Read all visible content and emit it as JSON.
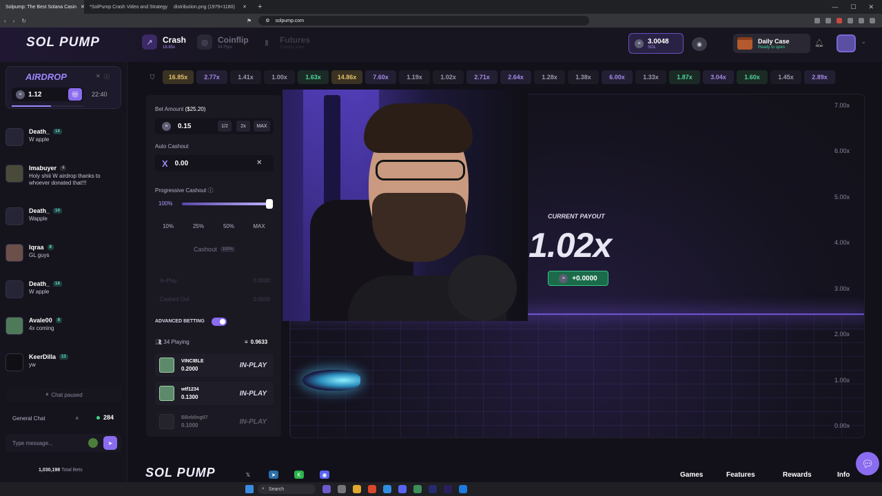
{
  "browser": {
    "tabs": [
      {
        "title": "Solpump: The Best Solana Casin",
        "active": true
      },
      {
        "title": "*SolPump Crash Video and Strategy",
        "active": false
      },
      {
        "title": "distribution.png (1979×1180)",
        "active": false
      }
    ],
    "url": "solpump.com"
  },
  "header": {
    "logo": "SOL PUMP",
    "games": [
      {
        "name": "Crash",
        "sub": "18.85x",
        "icon": "chart-up-icon"
      },
      {
        "name": "Coinflip",
        "sub": "34 Flips",
        "icon": "coin-icon"
      },
      {
        "name": "Futures",
        "sub": "Coming soon",
        "icon": "bars-icon"
      }
    ],
    "balance": {
      "amount": "3.0048",
      "currency": "SOL"
    },
    "daily_case": {
      "title": "Daily Case",
      "status": "Ready to open"
    }
  },
  "airdrop": {
    "title": "AIRDROP",
    "amount": "1.12",
    "timer": "22:40",
    "progress": 0.55
  },
  "chat": {
    "messages": [
      {
        "user": "Death_",
        "level": "14",
        "text": "W apple"
      },
      {
        "user": "Imabuyer",
        "level": "4",
        "text": "Holy shiii W airdrop thanks to whoever donated that!!!"
      },
      {
        "user": "Death_",
        "level": "14",
        "text": "Wapple"
      },
      {
        "user": "Iqraa",
        "level": "8",
        "text": "GL guys"
      },
      {
        "user": "Death_",
        "level": "14",
        "text": "W apple"
      },
      {
        "user": "Avale00",
        "level": "8",
        "text": "4x coming"
      },
      {
        "user": "KeerDilla",
        "level": "13",
        "text": "yw"
      }
    ],
    "paused_label": "Chat paused",
    "channel": "General Chat",
    "online": "284",
    "placeholder": "Type message...",
    "total_bets_value": "1,030,198",
    "total_bets_label": "Total Bets"
  },
  "history": [
    {
      "v": "16.85x",
      "color": "#e3c16a",
      "bg": "#3a3222"
    },
    {
      "v": "2.77x",
      "color": "#a48ae6",
      "bg": "#231f33"
    },
    {
      "v": "1.41x",
      "color": "#9a98ac",
      "bg": "#1c1b26"
    },
    {
      "v": "1.00x",
      "color": "#9a98ac",
      "bg": "#1c1b26"
    },
    {
      "v": "1.63x",
      "color": "#4fd39a",
      "bg": "#1b2a25"
    },
    {
      "v": "14.86x",
      "color": "#e3c16a",
      "bg": "#3a3222"
    },
    {
      "v": "7.60x",
      "color": "#a48ae6",
      "bg": "#231f33"
    },
    {
      "v": "1.19x",
      "color": "#9a98ac",
      "bg": "#1c1b26"
    },
    {
      "v": "1.02x",
      "color": "#9a98ac",
      "bg": "#1c1b26"
    },
    {
      "v": "2.71x",
      "color": "#a48ae6",
      "bg": "#231f33"
    },
    {
      "v": "2.64x",
      "color": "#a48ae6",
      "bg": "#231f33"
    },
    {
      "v": "1.28x",
      "color": "#9a98ac",
      "bg": "#1c1b26"
    },
    {
      "v": "1.38x",
      "color": "#9a98ac",
      "bg": "#1c1b26"
    },
    {
      "v": "6.00x",
      "color": "#a48ae6",
      "bg": "#231f33"
    },
    {
      "v": "1.33x",
      "color": "#9a98ac",
      "bg": "#1c1b26"
    },
    {
      "v": "1.87x",
      "color": "#4fd39a",
      "bg": "#1b2a25"
    },
    {
      "v": "3.04x",
      "color": "#a48ae6",
      "bg": "#231f33"
    },
    {
      "v": "1.60x",
      "color": "#4fd39a",
      "bg": "#1b2a25"
    },
    {
      "v": "1.45x",
      "color": "#9a98ac",
      "bg": "#1c1b26"
    },
    {
      "v": "2.89x",
      "color": "#a48ae6",
      "bg": "#231f33"
    }
  ],
  "bet": {
    "bet_amount_label": "Bet Amount",
    "bet_amount_usd": "($25.20)",
    "bet_amount": "0.15",
    "half_label": "1/2",
    "double_label": "2x",
    "max_label": "MAX",
    "auto_cashout_label": "Auto Cashout",
    "auto_cashout": "0.00",
    "progressive_label": "Progressive Cashout",
    "progressive_pct": "100%",
    "progressive_value": 1.0,
    "pct_options": [
      "10%",
      "25%",
      "50%",
      "MAX"
    ],
    "cashout_label": "Cashout",
    "cashout_tag": "100%",
    "in_play_label": "In-Play",
    "in_play_value": "0.0000",
    "cashed_out_label": "Cashed Out",
    "cashed_out_value": "0.0000",
    "advanced_label": "ADVANCED BETTING",
    "playing_label": "34 Playing",
    "pot": "0.9633",
    "players": [
      {
        "name": "VINCIBLE",
        "bet": "0.2000",
        "status": "IN-PLAY"
      },
      {
        "name": "wtf1234",
        "bet": "0.1300",
        "status": "IN-PLAY"
      },
      {
        "name": "BBebling07",
        "bet": "0.1000",
        "status": "IN-PLAY"
      }
    ]
  },
  "game": {
    "payout_label": "CURRENT PAYOUT",
    "payout": "1.02x",
    "profit": "+0.0000",
    "y_ticks": [
      "7.00x",
      "6.00x",
      "5.00x",
      "4.00x",
      "3.00x",
      "2.00x",
      "1.00x",
      "0.00x"
    ]
  },
  "footer": {
    "logo": "SOL PUMP",
    "links": [
      "Games",
      "Features",
      "Rewards",
      "Info"
    ]
  },
  "taskbar": {
    "search": "Search"
  }
}
